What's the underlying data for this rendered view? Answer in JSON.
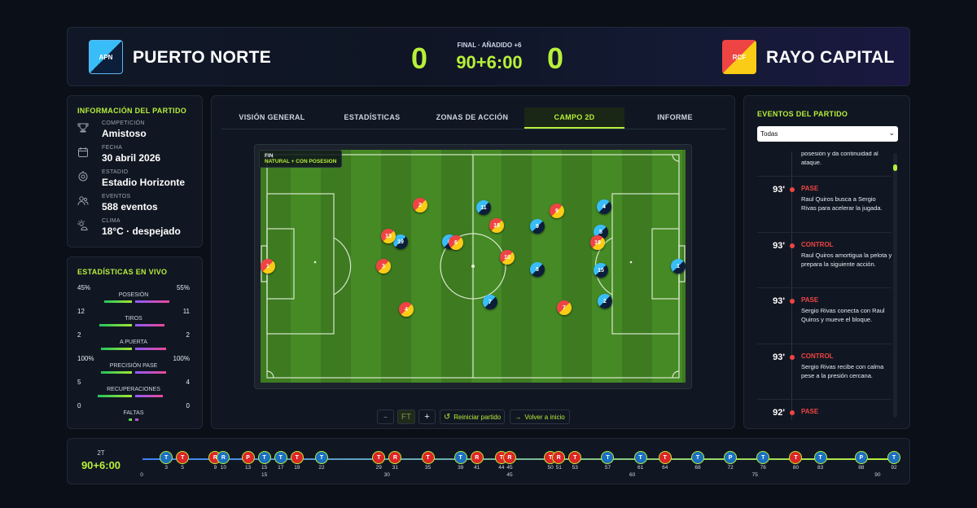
{
  "header": {
    "home": {
      "abbr": "APN",
      "name": "PUERTO NORTE",
      "score": "0"
    },
    "away": {
      "abbr": "RCF",
      "name": "RAYO CAPITAL",
      "score": "0"
    },
    "status": "FINAL · AÑADIDO +6",
    "clock": "90+6:00"
  },
  "info": {
    "title": "INFORMACIÓN DEL PARTIDO",
    "rows": [
      {
        "icon": "trophy-icon",
        "key": "COMPETICIÓN",
        "value": "Amistoso"
      },
      {
        "icon": "calendar-icon",
        "key": "FECHA",
        "value": "30 abril 2026"
      },
      {
        "icon": "stadium-icon",
        "key": "ESTADIO",
        "value": "Estadio Horizonte"
      },
      {
        "icon": "people-icon",
        "key": "EVENTOS",
        "value": "588 eventos"
      },
      {
        "icon": "weather-icon",
        "key": "CLIMA",
        "value": "18°C · despejado"
      }
    ]
  },
  "live": {
    "title": "ESTADÍSTICAS EN VIVO",
    "rows": [
      {
        "name": "POSESIÓN",
        "home": "45%",
        "away": "55%",
        "home_frac": 0.45,
        "away_frac": 0.55
      },
      {
        "name": "TIROS",
        "home": "12",
        "away": "11",
        "home_frac": 0.52,
        "away_frac": 0.48
      },
      {
        "name": "A PUERTA",
        "home": "2",
        "away": "2",
        "home_frac": 0.5,
        "away_frac": 0.5
      },
      {
        "name": "PRECISIÓN PASE",
        "home": "100%",
        "away": "100%",
        "home_frac": 0.5,
        "away_frac": 0.5
      },
      {
        "name": "RECUPERACIONES",
        "home": "5",
        "away": "4",
        "home_frac": 0.55,
        "away_frac": 0.45
      },
      {
        "name": "FALTAS",
        "home": "0",
        "away": "0",
        "home_frac": 0.05,
        "away_frac": 0.05
      }
    ]
  },
  "tabs": [
    "VISIÓN GENERAL",
    "ESTADÍSTICAS",
    "ZONAS DE ACCIÓN",
    "CAMPO 2D",
    "INFORME"
  ],
  "active_tab": "CAMPO 2D",
  "pitch": {
    "badge_title": "FIN",
    "badge_mode": "NATURAL + CON POSESION",
    "players_home": [
      "1",
      "11",
      "19",
      "6",
      "8",
      "9",
      "4",
      "5",
      "15",
      "7",
      "2",
      "10"
    ],
    "players_away": [
      "1",
      "2",
      "13",
      "3",
      "18",
      "10",
      "9",
      "19",
      "7",
      "4"
    ]
  },
  "controls": {
    "minus": "−",
    "ft": "FT",
    "plus": "+",
    "restart": "Reiniciar partido",
    "back": "Volver a inicio"
  },
  "events": {
    "title": "EVENTOS DEL PARTIDO",
    "filter": "Todas",
    "top_text": "posesión y da continuidad al ataque.",
    "items": [
      {
        "min": "93'",
        "type": "PASE",
        "text": "Raul Quiros busca a Sergio Rivas para acelerar la jugada."
      },
      {
        "min": "93'",
        "type": "CONTROL",
        "text": "Raul Quiros amortigua la pelota y prepara la siguiente acción."
      },
      {
        "min": "93'",
        "type": "PASE",
        "text": "Sergio Rivas conecta con Raul Quiros y mueve el bloque."
      },
      {
        "min": "93'",
        "type": "CONTROL",
        "text": "Sergio Rivas recibe con calma pese a la presión cercana."
      },
      {
        "min": "92'",
        "type": "PASE",
        "text": ""
      }
    ]
  },
  "timeline": {
    "period": "2T",
    "clock": "90+6:00",
    "axis": [
      "0",
      "15",
      "30",
      "45",
      "60",
      "75",
      "90"
    ],
    "markers": [
      {
        "letter": "T",
        "min": "3",
        "team": "blue"
      },
      {
        "letter": "T",
        "min": "5",
        "team": "red"
      },
      {
        "letter": "R",
        "min": "9",
        "team": "red"
      },
      {
        "letter": "R",
        "min": "10",
        "team": "blue"
      },
      {
        "letter": "P",
        "min": "13",
        "team": "red"
      },
      {
        "letter": "T",
        "min": "15",
        "team": "blue"
      },
      {
        "letter": "T",
        "min": "17",
        "team": "blue"
      },
      {
        "letter": "T",
        "min": "19",
        "team": "red"
      },
      {
        "letter": "T",
        "min": "22",
        "team": "blue"
      },
      {
        "letter": "T",
        "min": "29",
        "team": "red"
      },
      {
        "letter": "R",
        "min": "31",
        "team": "red"
      },
      {
        "letter": "T",
        "min": "35",
        "team": "red"
      },
      {
        "letter": "T",
        "min": "39",
        "team": "blue"
      },
      {
        "letter": "T",
        "min": "44",
        "team": "red"
      },
      {
        "letter": "R",
        "min": "45",
        "team": "red"
      },
      {
        "letter": "R",
        "min": "41",
        "team": "red"
      },
      {
        "letter": "T",
        "min": "50",
        "team": "red"
      },
      {
        "letter": "R",
        "min": "51",
        "team": "red"
      },
      {
        "letter": "T",
        "min": "53",
        "team": "red"
      },
      {
        "letter": "T",
        "min": "57",
        "team": "blue"
      },
      {
        "letter": "T",
        "min": "61",
        "team": "blue"
      },
      {
        "letter": "T",
        "min": "64",
        "team": "red"
      },
      {
        "letter": "T",
        "min": "68",
        "team": "blue"
      },
      {
        "letter": "P",
        "min": "72",
        "team": "blue"
      },
      {
        "letter": "T",
        "min": "76",
        "team": "blue"
      },
      {
        "letter": "T",
        "min": "80",
        "team": "red"
      },
      {
        "letter": "T",
        "min": "83",
        "team": "blue"
      },
      {
        "letter": "P",
        "min": "88",
        "team": "blue"
      },
      {
        "letter": "T",
        "min": "92",
        "team": "blue"
      }
    ]
  },
  "colors": {
    "accent": "#b7f03a",
    "home": "#38bdf8",
    "away": "#ef4444"
  }
}
